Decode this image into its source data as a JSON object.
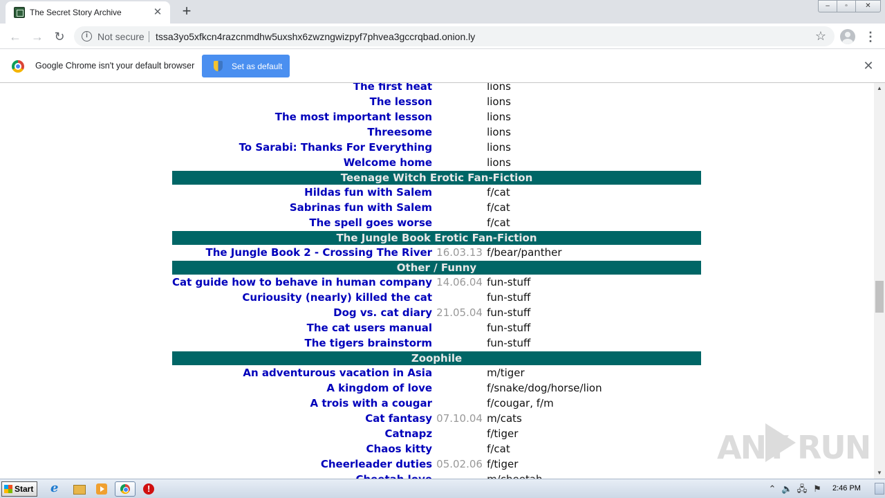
{
  "browser": {
    "tab_title": "The Secret Story Archive",
    "new_tab_symbol": "+",
    "close_symbol": "✕",
    "security_label": "Not secure",
    "url": "tssa3yo5xfkcn4razcnmdhw5uxshx6zwzngwizpyf7phvea3gccrqbad.onion.ly",
    "star_symbol": "☆",
    "menu_symbol": "⋮",
    "back_symbol": "←",
    "forward_symbol": "→",
    "reload_symbol": "↻"
  },
  "infobar": {
    "message": "Google Chrome isn't your default browser",
    "button_label": "Set as default",
    "close_symbol": "✕"
  },
  "stories": [
    {
      "type": "row",
      "title": "The first heat",
      "date": "",
      "tags": "lions"
    },
    {
      "type": "row",
      "title": "The lesson",
      "date": "",
      "tags": "lions"
    },
    {
      "type": "row",
      "title": "The most important lesson",
      "date": "",
      "tags": "lions"
    },
    {
      "type": "row",
      "title": "Threesome",
      "date": "",
      "tags": "lions"
    },
    {
      "type": "row",
      "title": "To Sarabi: Thanks For Everything",
      "date": "",
      "tags": "lions"
    },
    {
      "type": "row",
      "title": "Welcome home",
      "date": "",
      "tags": "lions"
    },
    {
      "type": "section",
      "title": "Teenage Witch Erotic Fan-Fiction"
    },
    {
      "type": "row",
      "title": "Hildas fun with Salem",
      "date": "",
      "tags": "f/cat"
    },
    {
      "type": "row",
      "title": "Sabrinas fun with Salem",
      "date": "",
      "tags": "f/cat"
    },
    {
      "type": "row",
      "title": "The spell goes worse",
      "date": "",
      "tags": "f/cat"
    },
    {
      "type": "section",
      "title": "The Jungle Book Erotic Fan-Fiction"
    },
    {
      "type": "row",
      "title": "The Jungle Book 2 - Crossing The River",
      "date": "16.03.13",
      "tags": "f/bear/panther"
    },
    {
      "type": "section",
      "title": "Other / Funny"
    },
    {
      "type": "row",
      "title": "Cat guide how to behave in human company",
      "date": "14.06.04",
      "tags": "fun-stuff"
    },
    {
      "type": "row",
      "title": "Curiousity (nearly) killed the cat",
      "date": "",
      "tags": "fun-stuff"
    },
    {
      "type": "row",
      "title": "Dog vs. cat diary",
      "date": "21.05.04",
      "tags": "fun-stuff"
    },
    {
      "type": "row",
      "title": "The cat users manual",
      "date": "",
      "tags": "fun-stuff"
    },
    {
      "type": "row",
      "title": "The tigers brainstorm",
      "date": "",
      "tags": "fun-stuff"
    },
    {
      "type": "section",
      "title": "Zoophile"
    },
    {
      "type": "row",
      "title": "An adventurous vacation in Asia",
      "date": "",
      "tags": "m/tiger"
    },
    {
      "type": "row",
      "title": "A kingdom of love",
      "date": "",
      "tags": "f/snake/dog/horse/lion"
    },
    {
      "type": "row",
      "title": "A trois with a cougar",
      "date": "",
      "tags": "f/cougar, f/m"
    },
    {
      "type": "row",
      "title": "Cat fantasy",
      "date": "07.10.04",
      "tags": "m/cats"
    },
    {
      "type": "row",
      "title": "Catnapz",
      "date": "",
      "tags": "f/tiger"
    },
    {
      "type": "row",
      "title": "Chaos kitty",
      "date": "",
      "tags": "f/cat"
    },
    {
      "type": "row",
      "title": "Cheerleader duties",
      "date": "05.02.06",
      "tags": "f/tiger"
    },
    {
      "type": "row",
      "title": "Cheetah love",
      "date": "",
      "tags": "m/cheetah"
    }
  ],
  "watermark": {
    "left": "ANY",
    "right": "RUN"
  },
  "taskbar": {
    "start_label": "Start",
    "clock": "2:46 PM",
    "tray_arrow": "⌃",
    "tray_volume": "🔈",
    "tray_network": "🖧",
    "tray_flag": "⚑"
  },
  "colors": {
    "section_bg": "#006666",
    "link": "#0000bb",
    "date": "#999999"
  }
}
